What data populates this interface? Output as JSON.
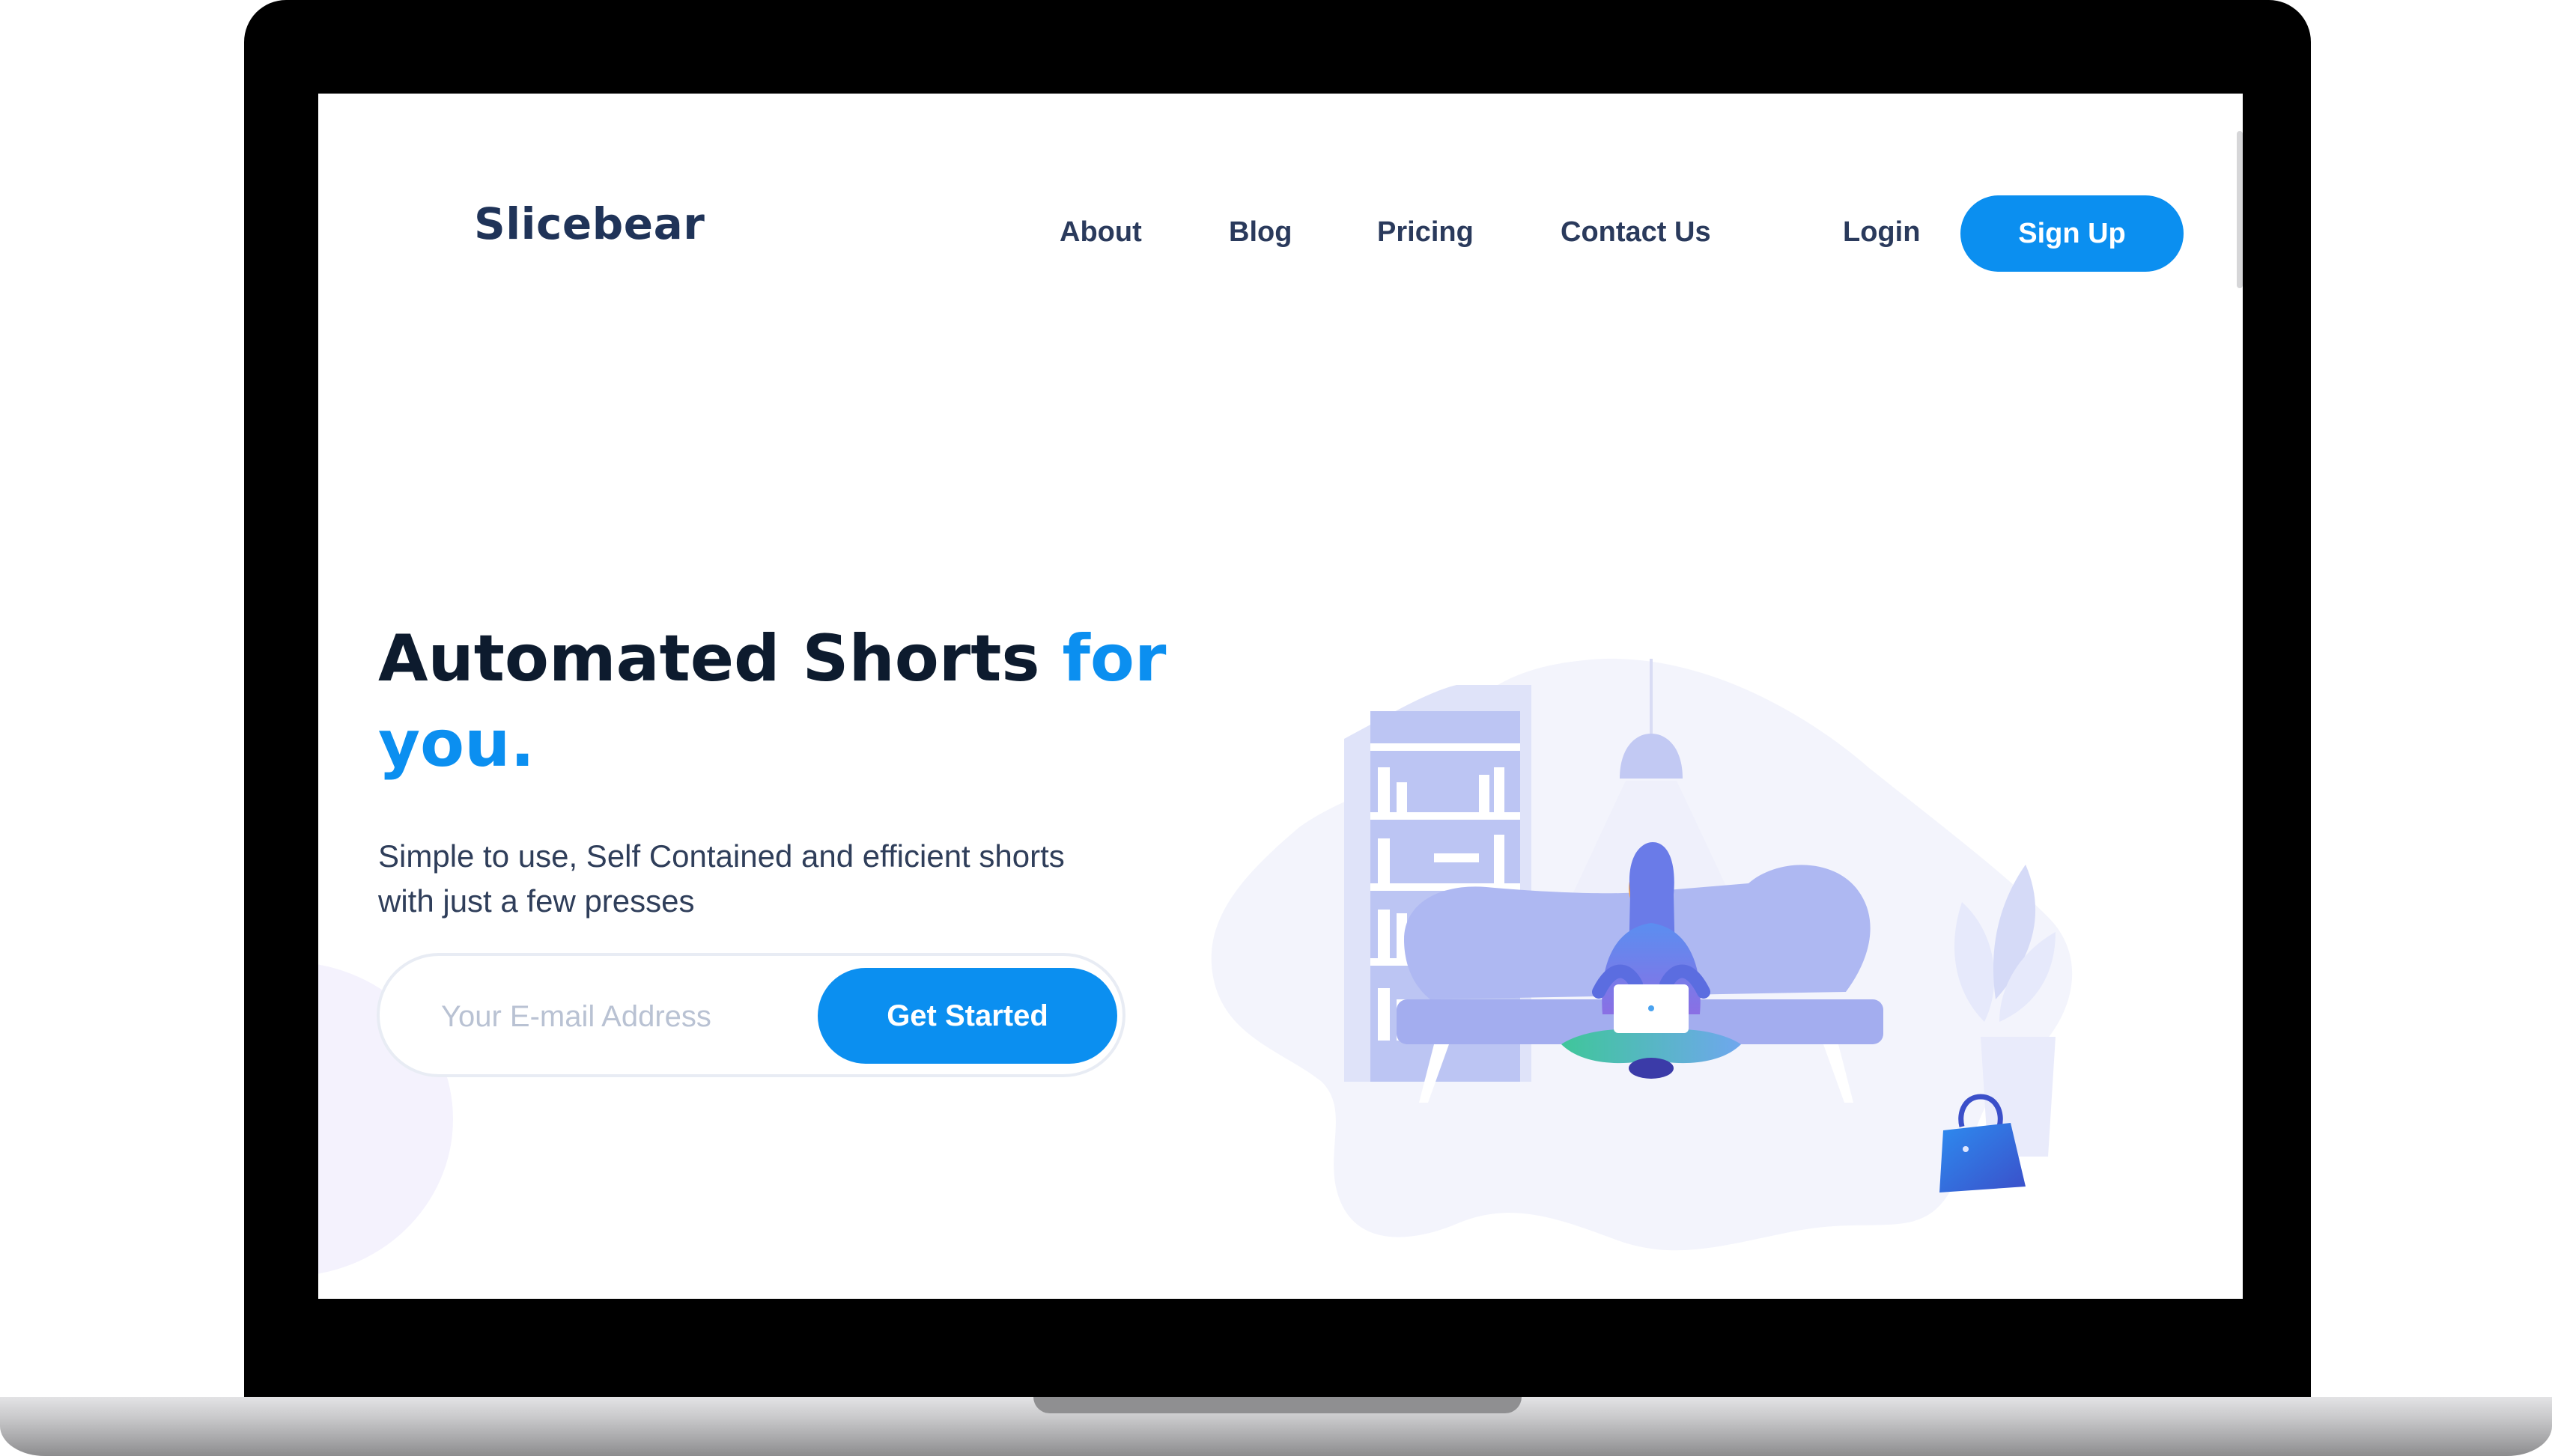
{
  "brand": {
    "name": "Slicebear"
  },
  "nav": {
    "links": [
      "About",
      "Blog",
      "Pricing",
      "Contact Us"
    ],
    "login_label": "Login",
    "signup_label": "Sign Up"
  },
  "hero": {
    "headline_main": "Automated Shorts ",
    "headline_accent": "for you.",
    "subtitle": "Simple to use, Self Contained and efficient shorts with just a few presses",
    "email_placeholder": "Your E-mail Address",
    "cta_label": "Get Started"
  },
  "illustration": {
    "icons": [
      "pendant-lamp-icon",
      "bookshelf-icon",
      "sofa-icon",
      "person-with-laptop-icon",
      "plant-icon",
      "handbag-icon"
    ]
  },
  "colors": {
    "accent": "#0b8ff0",
    "brand_text": "#1f3358",
    "headline_text": "#0d1b2e",
    "illustration_primary": "#a9b4f2",
    "illustration_background": "#f3f4fc"
  }
}
